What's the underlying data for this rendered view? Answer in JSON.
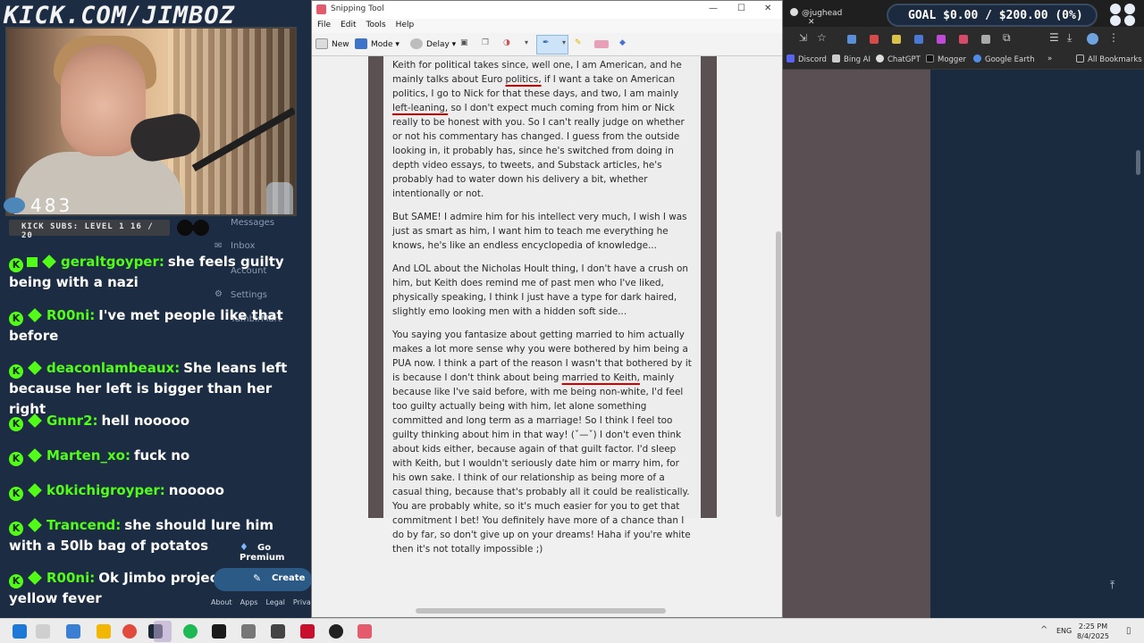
{
  "overlay": {
    "brand": "KICK.COM/JIMBOZ",
    "viewer_count": "483",
    "subs_label": "KICK SUBS: LEVEL 1 16 / 20",
    "ghost_nav": [
      "Messages",
      "Inbox",
      "Account",
      "Settings",
      "TumblrMart"
    ],
    "go_premium": "Go Premium",
    "create": "Create",
    "footer_links": [
      "About",
      "Apps",
      "Legal",
      "Privac"
    ]
  },
  "chat": {
    "messages": [
      {
        "user": "geraltgoyper:",
        "text": "she feels guilty being with a nazi"
      },
      {
        "user": "R00ni:",
        "text": "I've met people like that before"
      },
      {
        "user": "deaconlambeaux:",
        "text": "She leans left because her left is bigger than her right"
      },
      {
        "user": "Gnnr2:",
        "text": "hell nooooo"
      },
      {
        "user": "Marten_xo:",
        "text": "fuck no"
      },
      {
        "user": "k0kichigroyper:",
        "text": "nooooo"
      },
      {
        "user": "Trancend:",
        "text": "she should lure him with a 50lb bag of potatos"
      },
      {
        "user": "R00ni:",
        "text": "Ok Jimbo projecting his yellow fever"
      }
    ]
  },
  "snipping_tool": {
    "title": "Snipping Tool",
    "menu": [
      "File",
      "Edit",
      "Tools",
      "Help"
    ],
    "toolbar": {
      "new": "New",
      "mode": "Mode",
      "delay": "Delay"
    },
    "doc": {
      "p1a": "Keith for political takes since, well one, I am American, and he mainly talks about Euro ",
      "p1u1": "politics,",
      "p1b": " if I want a take on American politics, I go to Nick for that these days, and two, I am mainly ",
      "p1u2": "left-leaning,",
      "p1c": " so I don't expect much coming from him or Nick really to be honest with you. So I can't really judge on whether or not his commentary has changed. I guess from the outside looking in, it probably has, since he's switched from doing in depth video essays, to tweets, and Substack articles, he's probably had to water down his delivery a bit, whether intentionally or not.",
      "p2": "But SAME! I admire him for his intellect very much, I wish I was just as smart as him, I want him to teach me everything he knows, he's like an endless encyclopedia of knowledge...",
      "p3": "And LOL about the Nicholas Hoult thing, I don't have a crush on him, but Keith does remind me of past men who I've liked, physically speaking, I think I just have a type for dark haired, slightly emo looking men with a hidden soft side...",
      "p4a": "You saying you fantasize about getting married to him actually makes a lot more sense why you were bothered by him being a PUA now. I think a part of the reason I wasn't that bothered by it is because I don't think about being ",
      "p4u": "married to Keith,",
      "p4b": " mainly because like I've said before, with me being non-white, I'd feel too guilty actually being with him, let alone something committed and long term as a marriage! So I think I feel too guilty thinking about him in that way! (ˇ—ˇ) I don't even think about kids either, because again of that guilt factor. I'd sleep with Keith, but I wouldn't seriously date him or marry him, for his own sake. I think of our relationship as being more of a casual thing, because that's probably all it could be realistically. You are probably white, so it's much easier for you to get that commitment I bet! You definitely have more of a chance than I do by far, so don't give up on your dreams! Haha if you're white then it's not totally impossible ;)"
    }
  },
  "browser": {
    "tab": "@jughead",
    "goal": "GOAL $0.00 / $200.00 (0%)",
    "bookmarks": [
      "Discord",
      "Bing AI",
      "ChatGPT",
      "Mogger",
      "Google Earth"
    ],
    "all_bookmarks": "All Bookmarks"
  },
  "taskbar": {
    "lang": "ENG",
    "time": "2:25 PM",
    "date": "8/4/2025"
  },
  "colors": {
    "kick_green": "#53fc18",
    "chat_bg": "#1c2d43",
    "annotation_red": "#d40000"
  }
}
